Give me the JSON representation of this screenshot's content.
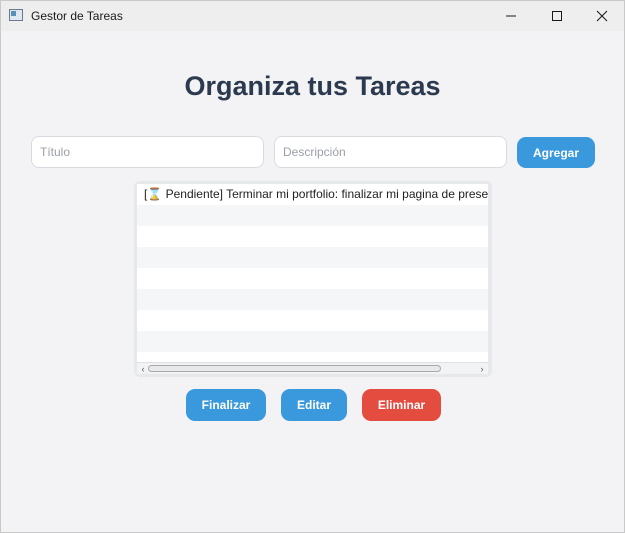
{
  "window": {
    "title": "Gestor de Tareas",
    "icon": "app-window-icon"
  },
  "controls": {
    "minimize_icon": "minimize-icon",
    "maximize_icon": "maximize-icon",
    "close_icon": "close-icon"
  },
  "main": {
    "heading": "Organiza tus Tareas",
    "title_input": {
      "placeholder": "Título",
      "value": ""
    },
    "description_input": {
      "placeholder": "Descripción",
      "value": ""
    },
    "add_label": "Agregar"
  },
  "task_list": {
    "items": [
      "[⌛ Pendiente] Terminar mi portfolio: finalizar mi pagina de presentacion"
    ],
    "scroll_left_icon": "chevron-left-icon",
    "scroll_right_icon": "chevron-right-icon"
  },
  "actions": {
    "finish_label": "Finalizar",
    "edit_label": "Editar",
    "delete_label": "Eliminar"
  },
  "colors": {
    "primary": "#3a98dc",
    "danger": "#e44c40",
    "heading": "#2b3a4e",
    "background": "#f3f3f5"
  }
}
